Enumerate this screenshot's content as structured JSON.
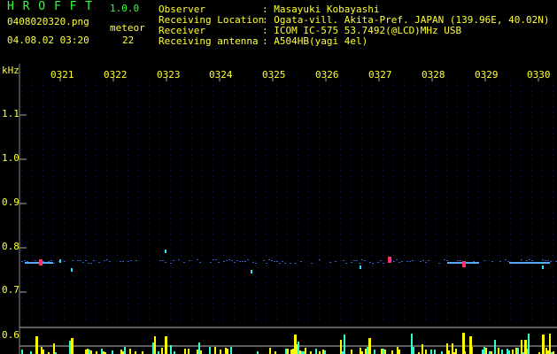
{
  "app": {
    "name": "H R O F F T",
    "version": "1.0.0"
  },
  "file": {
    "name": "0408020320.png",
    "datetime": "04.08.02 03:20"
  },
  "meteor": {
    "label": "meteor",
    "count": "22"
  },
  "info": [
    {
      "key": "Observer",
      "value": ": Masayuki Kobayashi"
    },
    {
      "key": "Receiving Location",
      "value": ": Ogata-vill. Akita-Pref. JAPAN (139.96E, 40.02N)"
    },
    {
      "key": "Receiver",
      "value": ": ICOM IC-575 53.7492(@LCD)MHz USB"
    },
    {
      "key": "Receiving antenna",
      "value": ": A504HB(yagi 4el)"
    }
  ],
  "axis": {
    "unit": "kHz",
    "y_ticks": [
      "1.1",
      "1.0",
      "0.9",
      "0.8",
      "0.7",
      "0.6"
    ],
    "x_ticks": [
      "0321",
      "0322",
      "0323",
      "0324",
      "0325",
      "0326",
      "0327",
      "0328",
      "0329",
      "0330"
    ]
  },
  "colors": {
    "text": "#ffff33",
    "title": "#33ff33",
    "grid": "#1a1a66",
    "signal": "#3377ff",
    "meteor_bar": "#ffff00",
    "meteor_hit": "#ff3366"
  }
}
